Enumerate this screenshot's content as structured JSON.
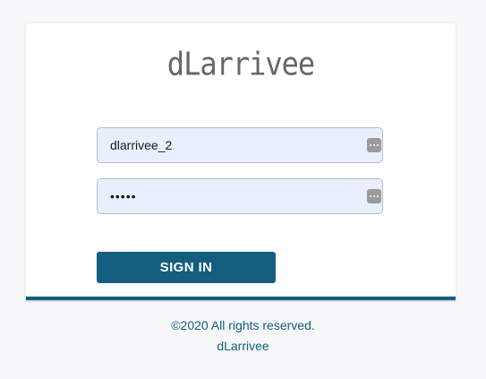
{
  "brand": {
    "logo_text": "dLarrivee"
  },
  "login_form": {
    "username_value": "dlarrivee_2",
    "password_value": "•••••",
    "sign_in_label": "SIGN IN"
  },
  "footer": {
    "copyright": "©2020 All rights reserved.",
    "company": "dLarrivee"
  },
  "icons": {
    "field_autofill": "password-manager-key-icon"
  },
  "colors": {
    "accent": "#135e7f",
    "input_fill": "#e8effd",
    "page_background": "#f6f7f9"
  }
}
